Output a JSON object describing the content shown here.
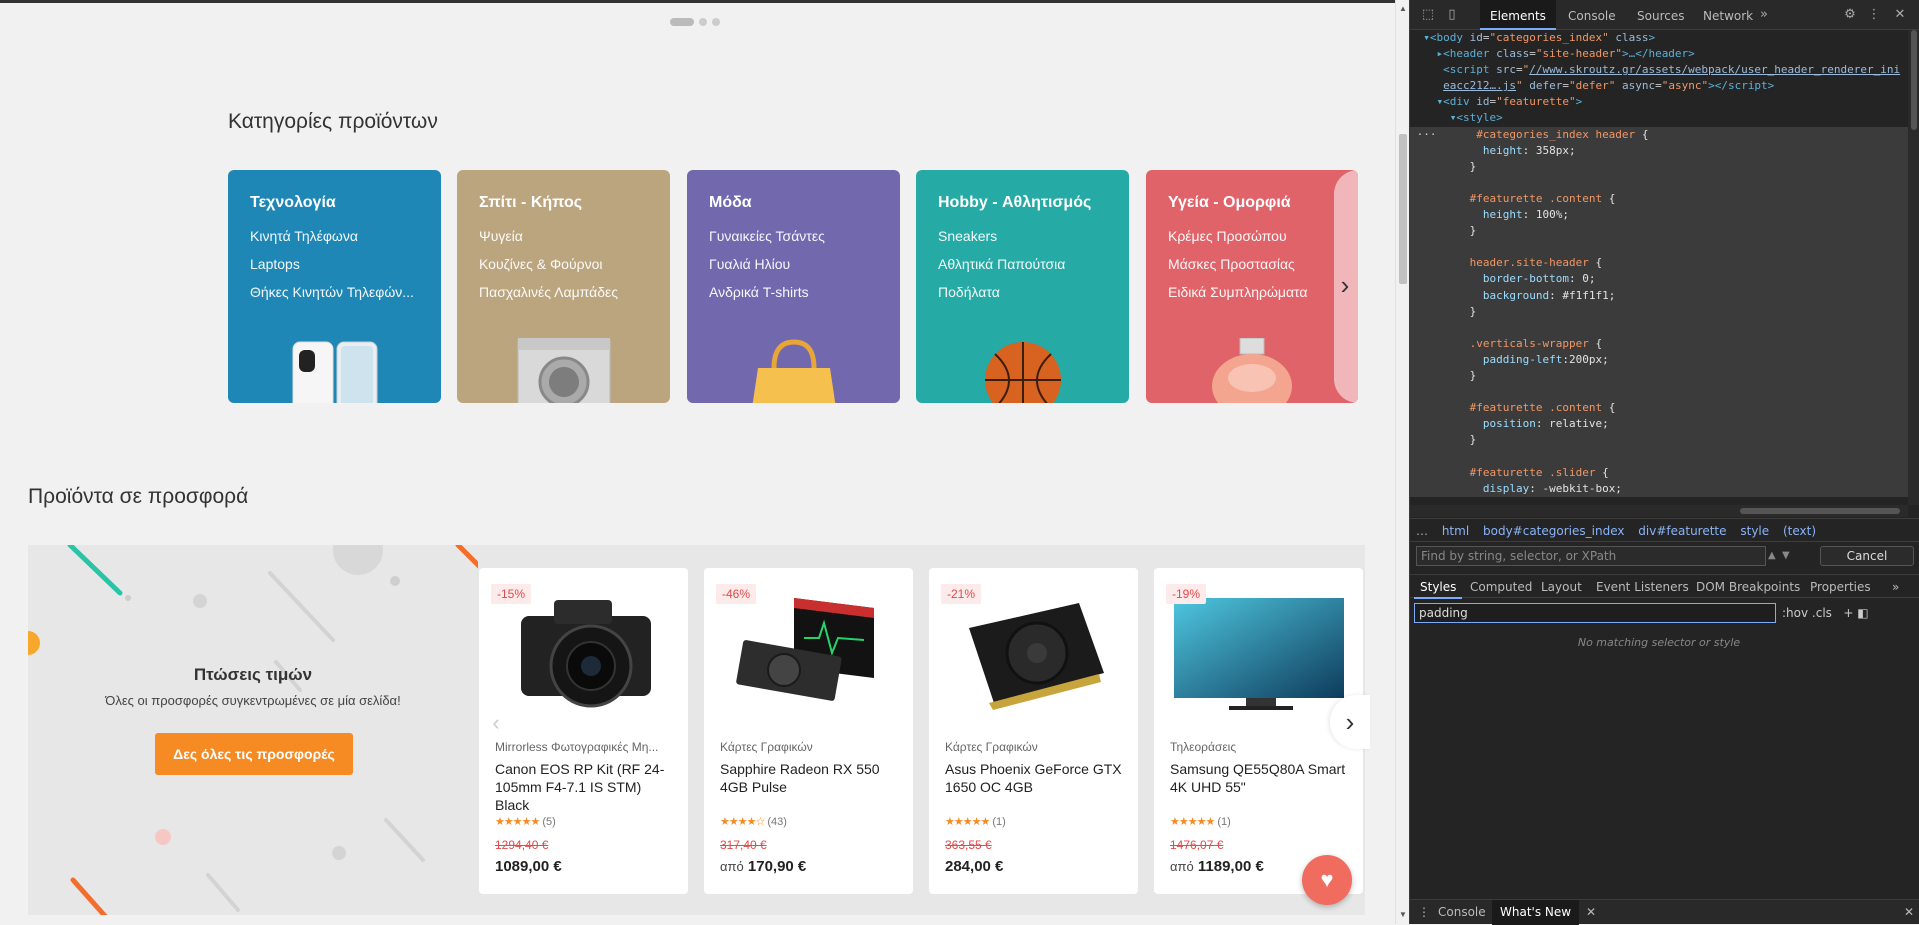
{
  "categories_section": {
    "title": "Κατηγορίες προϊόντων",
    "cards": [
      {
        "name": "Τεχνολογία",
        "color": "#1f87b5",
        "links": [
          "Κινητά Τηλέφωνα",
          "Laptops",
          "Θήκες Κινητών Τηλεφών..."
        ]
      },
      {
        "name": "Σπίτι - Κήπος",
        "color": "#bba57f",
        "links": [
          "Ψυγεία",
          "Κουζίνες & Φούρνοι",
          "Πασχαλινές Λαμπάδες"
        ]
      },
      {
        "name": "Μόδα",
        "color": "#7168ae",
        "links": [
          "Γυναικείες Τσάντες",
          "Γυαλιά Ηλίου",
          "Ανδρικά T-shirts"
        ]
      },
      {
        "name": "Hobby - Αθλητισμός",
        "color": "#26aaa5",
        "links": [
          "Sneakers",
          "Αθλητικά Παπούτσια",
          "Ποδήλατα"
        ]
      },
      {
        "name": "Υγεία - Ομορφιά",
        "color": "#e0636a",
        "links": [
          "Κρέμες Προσώπου",
          "Μάσκες Προστασίας",
          "Ειδικά Συμπληρώματα"
        ]
      }
    ]
  },
  "deals_section": {
    "title": "Προϊόντα σε προσφορά",
    "promo_title": "Πτώσεις τιμών",
    "promo_subtitle": "Όλες οι προσφορές συγκεντρωμένες σε μία σελίδα!",
    "promo_button": "Δες όλες τις προσφορές",
    "products": [
      {
        "discount": "-15%",
        "category": "Mirrorless Φωτογραφικές Μη...",
        "name": "Canon EOS RP Kit (RF 24-105mm F4-7.1 IS STM) Black",
        "stars": "★★★★★",
        "reviews": "(5)",
        "old_price": "1294,40 €",
        "from": "",
        "price": "1089,00 €"
      },
      {
        "discount": "-46%",
        "category": "Κάρτες Γραφικών",
        "name": "Sapphire Radeon RX 550 4GB Pulse",
        "stars": "★★★★☆",
        "reviews": "(43)",
        "old_price": "317,40 €",
        "from": "από",
        "price": "170,90 €"
      },
      {
        "discount": "-21%",
        "category": "Κάρτες Γραφικών",
        "name": "Asus Phoenix GeForce GTX 1650 OC 4GB",
        "stars": "★★★★★",
        "reviews": "(1)",
        "old_price": "363,55 €",
        "from": "",
        "price": "284,00 €"
      },
      {
        "discount": "-19%",
        "category": "Τηλεοράσεις",
        "name": "Samsung QE55Q80A Smart 4K UHD 55\"",
        "stars": "★★★★★",
        "reviews": "(1)",
        "old_price": "1476,07 €",
        "from": "από",
        "price": "1189,00 €"
      }
    ]
  },
  "devtools": {
    "tabs": [
      "Elements",
      "Console",
      "Sources",
      "Network"
    ],
    "breadcrumb": [
      "html",
      "body#categories_index",
      "div#featurette",
      "style",
      "(text)"
    ],
    "find_placeholder": "Find by string, selector, or XPath",
    "cancel_label": "Cancel",
    "styles_tabs": [
      "Styles",
      "Computed",
      "Layout",
      "Event Listeners",
      "DOM Breakpoints",
      "Properties"
    ],
    "filter_value": "padding",
    "filter_tools": ":hov .cls",
    "no_match": "No matching selector or style",
    "drawer_tabs": [
      "Console",
      "What's New"
    ]
  }
}
